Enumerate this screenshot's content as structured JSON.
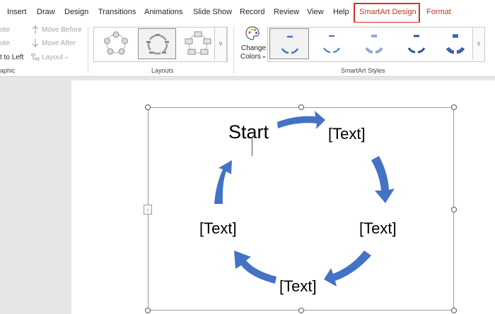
{
  "tabs": [
    {
      "label": "Insert"
    },
    {
      "label": "Draw"
    },
    {
      "label": "Design"
    },
    {
      "label": "Transitions"
    },
    {
      "label": "Animations"
    },
    {
      "label": "Slide Show"
    },
    {
      "label": "Record"
    },
    {
      "label": "Review"
    },
    {
      "label": "View"
    },
    {
      "label": "Help"
    },
    {
      "label": "SmartArt Design"
    },
    {
      "label": "Format"
    }
  ],
  "ribbon": {
    "create_graphic": {
      "promote_partial": "ote",
      "demote_partial": "ote",
      "rtl_partial": "t to Left",
      "move_before": "Move Before",
      "move_after": "Move After",
      "layout": "Layout",
      "group_label_partial": "aphic"
    },
    "layouts": {
      "group_label": "Layouts"
    },
    "change_colors": {
      "line1": "Change",
      "line2": "Colors"
    },
    "smartart_styles": {
      "group_label": "SmartArt Styles"
    }
  },
  "diagram": {
    "nodes": [
      {
        "text": "Start"
      },
      {
        "text": "[Text]"
      },
      {
        "text": "[Text]"
      },
      {
        "text": "[Text]"
      },
      {
        "text": "[Text]"
      }
    ],
    "arrow_color": "#4472c4"
  },
  "colors": {
    "accent_tab": "#b83b1e",
    "highlight": "#d92b2b",
    "arrow": "#4472c4"
  }
}
